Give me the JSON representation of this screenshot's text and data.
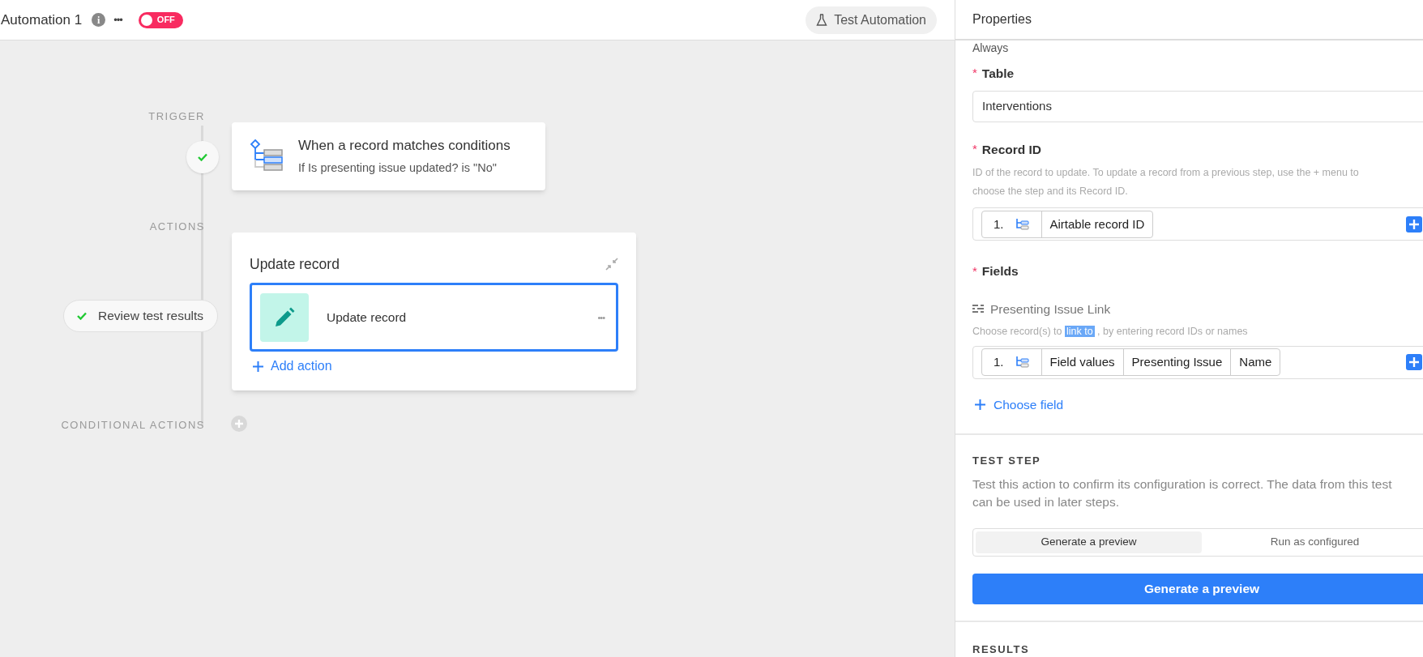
{
  "header": {
    "title": "Automation 1",
    "info_icon": "i",
    "more": "•••",
    "toggle": {
      "label": "OFF",
      "on": false
    },
    "test_button": "Test Automation"
  },
  "canvas": {
    "trigger_label": "TRIGGER",
    "trigger_done": true,
    "trigger_card": {
      "title": "When a record matches conditions",
      "subtitle": "If Is presenting issue updated? is \"No\""
    },
    "actions_label": "ACTIONS",
    "review": {
      "label": "Review test results",
      "done": true
    },
    "action_card": {
      "title": "Update record",
      "step": {
        "title": "Update record",
        "more": "•••",
        "selected": true
      },
      "add": "Add action"
    },
    "conditional_label": "CONDITIONAL ACTIONS"
  },
  "properties": {
    "title": "Properties",
    "cut_text": "Always",
    "table": {
      "label": "Table",
      "required_mark": "*",
      "value": "Interventions"
    },
    "record_id": {
      "label": "Record ID",
      "required_mark": "*",
      "hint": "ID of the record to update. To update a record from a previous step, use the + menu to choose the step and its Record ID.",
      "tokens": [
        "1.",
        "Airtable record ID"
      ]
    },
    "fields": {
      "label": "Fields",
      "required_mark": "*",
      "field_name": "Presenting Issue Link",
      "hint_parts": [
        {
          "text": "Choose record(s) to",
          "selected": false
        },
        {
          "text": "link to",
          "selected": true
        },
        {
          "text": ", by entering record IDs or names",
          "selected": false
        }
      ],
      "tokens": [
        "1.",
        "Field values",
        "Presenting Issue",
        "Name"
      ],
      "choose": "Choose field"
    },
    "test_step": {
      "title": "TEST STEP",
      "description": "Test this action to confirm its configuration is correct. The data from this test can be used in later steps.",
      "modes": [
        {
          "label": "Generate a preview",
          "selected": true
        },
        {
          "label": "Run as configured",
          "selected": false
        }
      ],
      "button": "Generate a preview"
    },
    "results_title": "RESULTS"
  }
}
